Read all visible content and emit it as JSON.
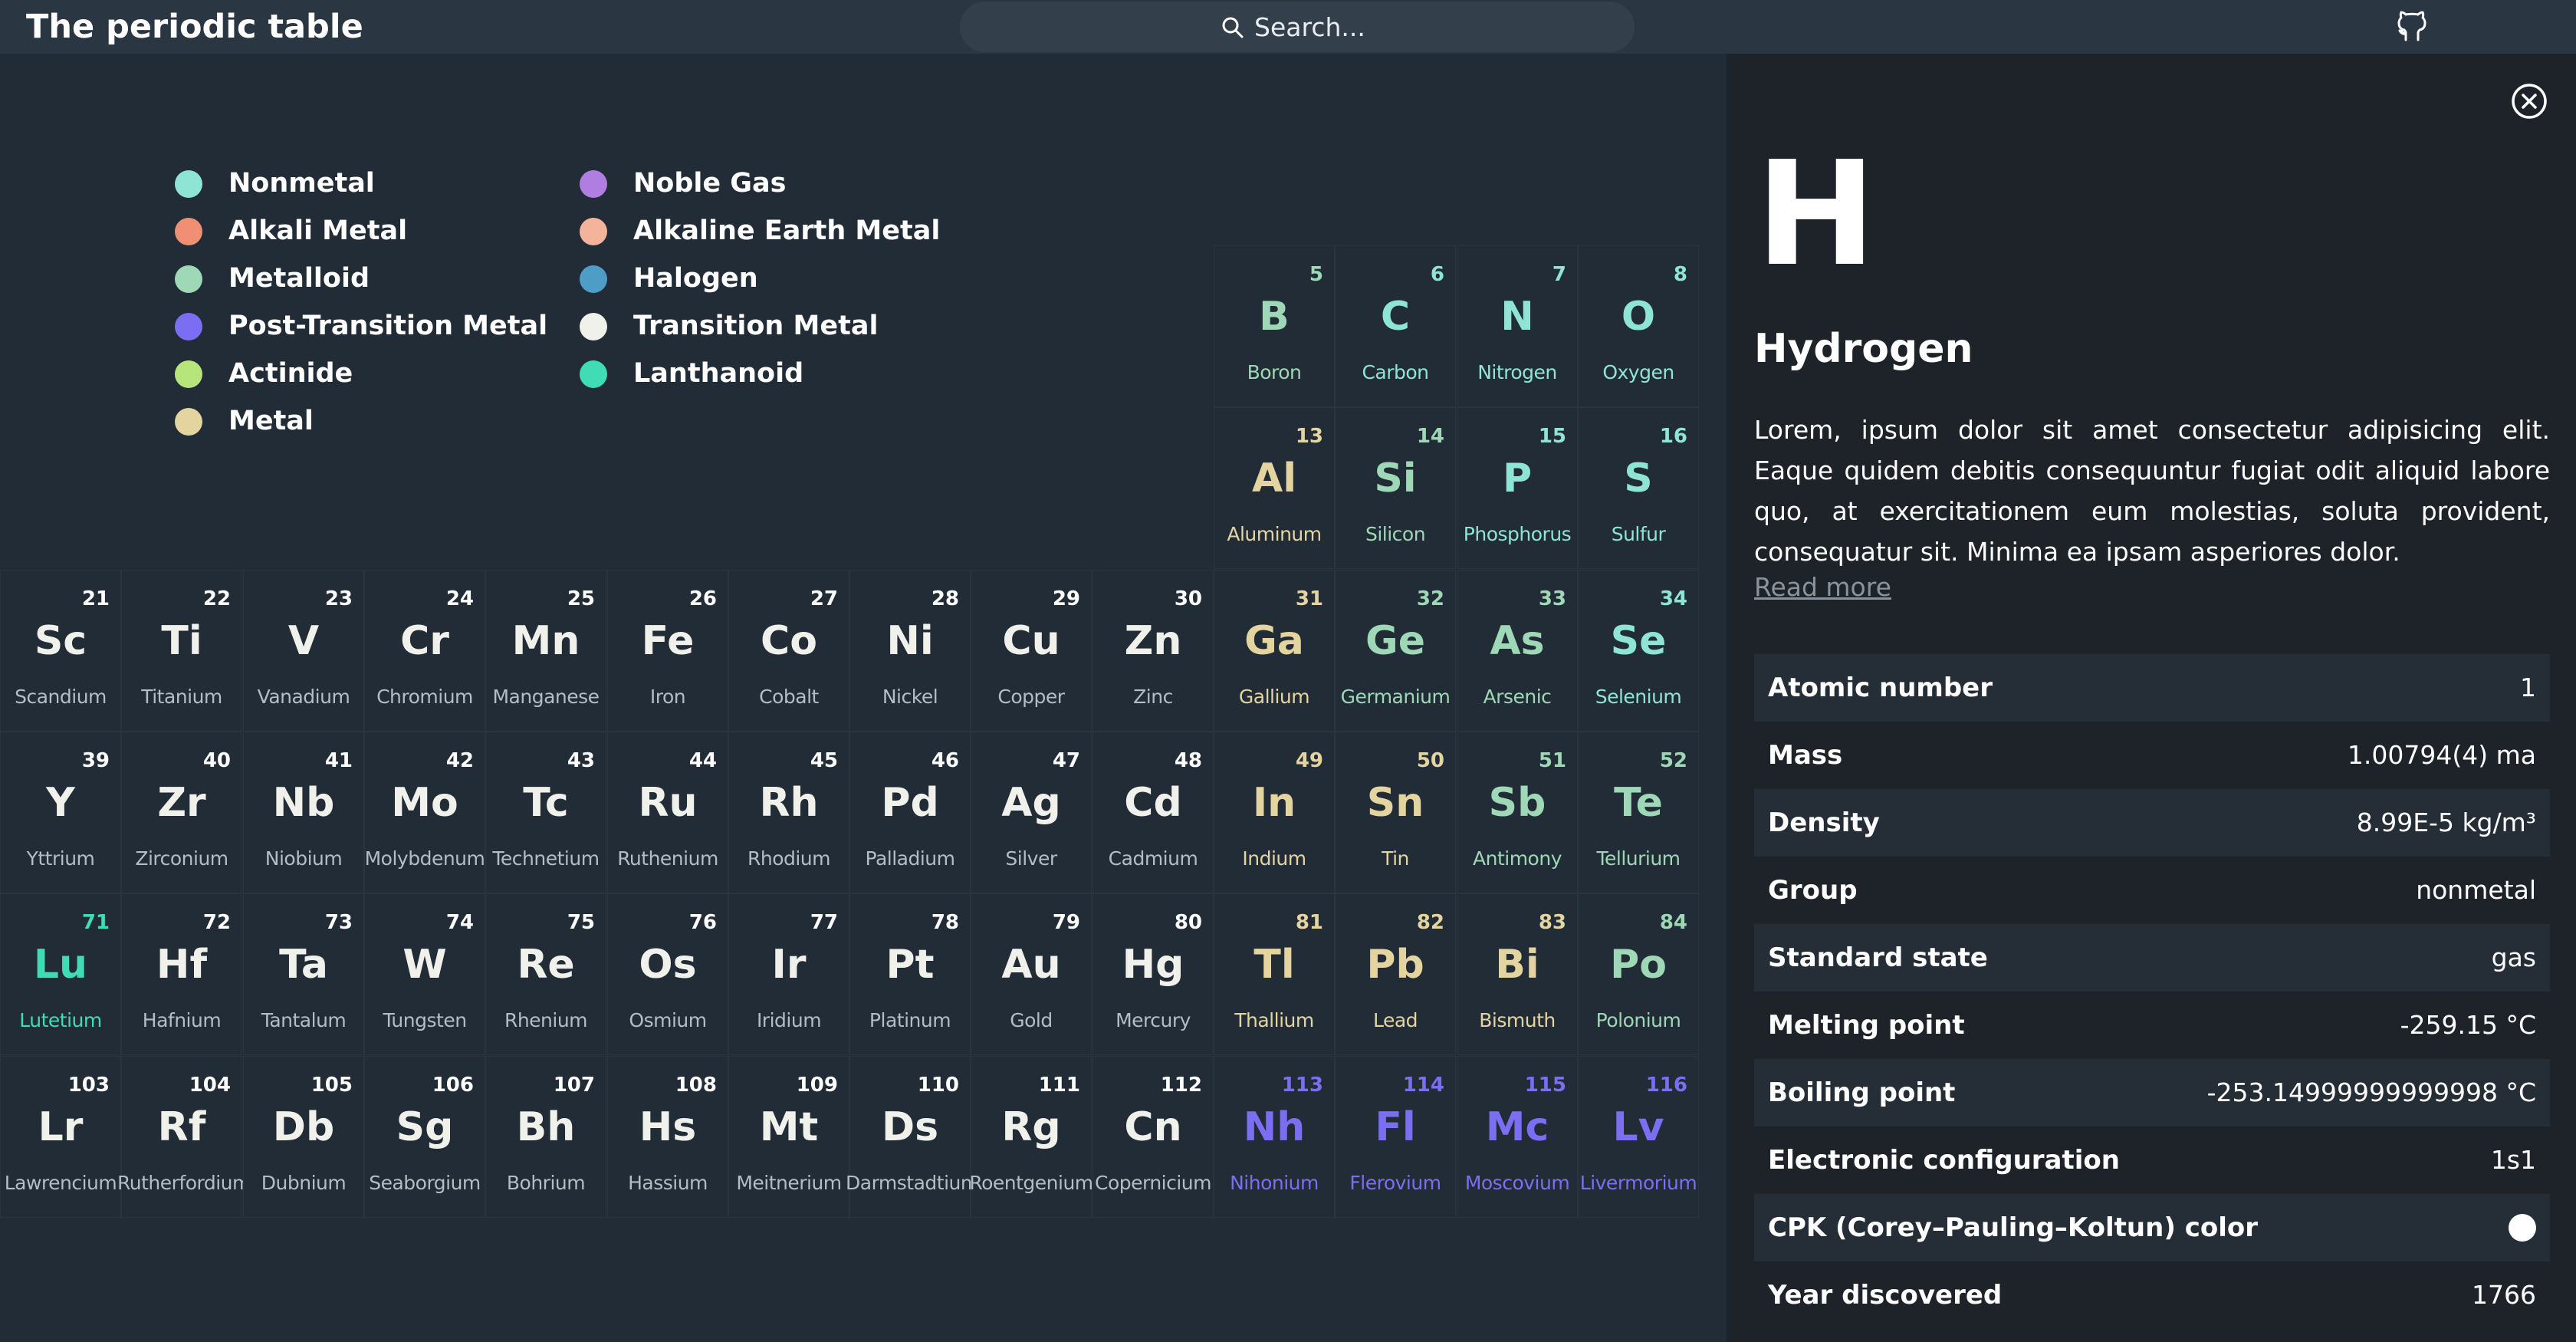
{
  "header": {
    "title": "The periodic table",
    "search_placeholder": "Search..."
  },
  "legend": [
    {
      "label": "Nonmetal",
      "color": "#8fe5d4"
    },
    {
      "label": "Alkali Metal",
      "color": "#f08f74"
    },
    {
      "label": "Metalloid",
      "color": "#9fd8b6"
    },
    {
      "label": "Post-Transition Metal",
      "color": "#7b6ef2"
    },
    {
      "label": "Actinide",
      "color": "#b6e57b"
    },
    {
      "label": "Metal",
      "color": "#e4d4a0"
    },
    {
      "label": "Noble Gas",
      "color": "#b07ee0"
    },
    {
      "label": "Alkaline Earth Metal",
      "color": "#f4b49c"
    },
    {
      "label": "Halogen",
      "color": "#4e9dc7"
    },
    {
      "label": "Transition Metal",
      "color": "#f1f1ec"
    },
    {
      "label": "Lanthanoid",
      "color": "#3fdcb6"
    }
  ],
  "elements": [
    {
      "num": "5",
      "sym": "B",
      "name": "Boron",
      "color": "#9fd8b6",
      "row": 0,
      "col": 10
    },
    {
      "num": "6",
      "sym": "C",
      "name": "Carbon",
      "color": "#8fe5d4",
      "row": 0,
      "col": 11
    },
    {
      "num": "7",
      "sym": "N",
      "name": "Nitrogen",
      "color": "#8fe5d4",
      "row": 0,
      "col": 12
    },
    {
      "num": "8",
      "sym": "O",
      "name": "Oxygen",
      "color": "#8fe5d4",
      "row": 0,
      "col": 13
    },
    {
      "num": "13",
      "sym": "Al",
      "name": "Aluminum",
      "color": "#e4d4a0",
      "row": 1,
      "col": 10
    },
    {
      "num": "14",
      "sym": "Si",
      "name": "Silicon",
      "color": "#9fd8b6",
      "row": 1,
      "col": 11
    },
    {
      "num": "15",
      "sym": "P",
      "name": "Phosphorus",
      "color": "#8fe5d4",
      "row": 1,
      "col": 12
    },
    {
      "num": "16",
      "sym": "S",
      "name": "Sulfur",
      "color": "#8fe5d4",
      "row": 1,
      "col": 13
    },
    {
      "num": "21",
      "sym": "Sc",
      "name": "Scandium",
      "color": "#f1f1ec",
      "row": 2,
      "col": 0
    },
    {
      "num": "22",
      "sym": "Ti",
      "name": "Titanium",
      "color": "#f1f1ec",
      "row": 2,
      "col": 1
    },
    {
      "num": "23",
      "sym": "V",
      "name": "Vanadium",
      "color": "#f1f1ec",
      "row": 2,
      "col": 2
    },
    {
      "num": "24",
      "sym": "Cr",
      "name": "Chromium",
      "color": "#f1f1ec",
      "row": 2,
      "col": 3
    },
    {
      "num": "25",
      "sym": "Mn",
      "name": "Manganese",
      "color": "#f1f1ec",
      "row": 2,
      "col": 4
    },
    {
      "num": "26",
      "sym": "Fe",
      "name": "Iron",
      "color": "#f1f1ec",
      "row": 2,
      "col": 5
    },
    {
      "num": "27",
      "sym": "Co",
      "name": "Cobalt",
      "color": "#f1f1ec",
      "row": 2,
      "col": 6
    },
    {
      "num": "28",
      "sym": "Ni",
      "name": "Nickel",
      "color": "#f1f1ec",
      "row": 2,
      "col": 7
    },
    {
      "num": "29",
      "sym": "Cu",
      "name": "Copper",
      "color": "#f1f1ec",
      "row": 2,
      "col": 8
    },
    {
      "num": "30",
      "sym": "Zn",
      "name": "Zinc",
      "color": "#f1f1ec",
      "row": 2,
      "col": 9
    },
    {
      "num": "31",
      "sym": "Ga",
      "name": "Gallium",
      "color": "#e4d4a0",
      "row": 2,
      "col": 10
    },
    {
      "num": "32",
      "sym": "Ge",
      "name": "Germanium",
      "color": "#9fd8b6",
      "row": 2,
      "col": 11
    },
    {
      "num": "33",
      "sym": "As",
      "name": "Arsenic",
      "color": "#9fd8b6",
      "row": 2,
      "col": 12
    },
    {
      "num": "34",
      "sym": "Se",
      "name": "Selenium",
      "color": "#8fe5d4",
      "row": 2,
      "col": 13
    },
    {
      "num": "39",
      "sym": "Y",
      "name": "Yttrium",
      "color": "#f1f1ec",
      "row": 3,
      "col": 0
    },
    {
      "num": "40",
      "sym": "Zr",
      "name": "Zirconium",
      "color": "#f1f1ec",
      "row": 3,
      "col": 1
    },
    {
      "num": "41",
      "sym": "Nb",
      "name": "Niobium",
      "color": "#f1f1ec",
      "row": 3,
      "col": 2
    },
    {
      "num": "42",
      "sym": "Mo",
      "name": "Molybdenum",
      "color": "#f1f1ec",
      "row": 3,
      "col": 3
    },
    {
      "num": "43",
      "sym": "Tc",
      "name": "Technetium",
      "color": "#f1f1ec",
      "row": 3,
      "col": 4
    },
    {
      "num": "44",
      "sym": "Ru",
      "name": "Ruthenium",
      "color": "#f1f1ec",
      "row": 3,
      "col": 5
    },
    {
      "num": "45",
      "sym": "Rh",
      "name": "Rhodium",
      "color": "#f1f1ec",
      "row": 3,
      "col": 6
    },
    {
      "num": "46",
      "sym": "Pd",
      "name": "Palladium",
      "color": "#f1f1ec",
      "row": 3,
      "col": 7
    },
    {
      "num": "47",
      "sym": "Ag",
      "name": "Silver",
      "color": "#f1f1ec",
      "row": 3,
      "col": 8
    },
    {
      "num": "48",
      "sym": "Cd",
      "name": "Cadmium",
      "color": "#f1f1ec",
      "row": 3,
      "col": 9
    },
    {
      "num": "49",
      "sym": "In",
      "name": "Indium",
      "color": "#e4d4a0",
      "row": 3,
      "col": 10
    },
    {
      "num": "50",
      "sym": "Sn",
      "name": "Tin",
      "color": "#e4d4a0",
      "row": 3,
      "col": 11
    },
    {
      "num": "51",
      "sym": "Sb",
      "name": "Antimony",
      "color": "#9fd8b6",
      "row": 3,
      "col": 12
    },
    {
      "num": "52",
      "sym": "Te",
      "name": "Tellurium",
      "color": "#9fd8b6",
      "row": 3,
      "col": 13
    },
    {
      "num": "71",
      "sym": "Lu",
      "name": "Lutetium",
      "color": "#3fdcb6",
      "row": 4,
      "col": 0
    },
    {
      "num": "72",
      "sym": "Hf",
      "name": "Hafnium",
      "color": "#f1f1ec",
      "row": 4,
      "col": 1
    },
    {
      "num": "73",
      "sym": "Ta",
      "name": "Tantalum",
      "color": "#f1f1ec",
      "row": 4,
      "col": 2
    },
    {
      "num": "74",
      "sym": "W",
      "name": "Tungsten",
      "color": "#f1f1ec",
      "row": 4,
      "col": 3
    },
    {
      "num": "75",
      "sym": "Re",
      "name": "Rhenium",
      "color": "#f1f1ec",
      "row": 4,
      "col": 4
    },
    {
      "num": "76",
      "sym": "Os",
      "name": "Osmium",
      "color": "#f1f1ec",
      "row": 4,
      "col": 5
    },
    {
      "num": "77",
      "sym": "Ir",
      "name": "Iridium",
      "color": "#f1f1ec",
      "row": 4,
      "col": 6
    },
    {
      "num": "78",
      "sym": "Pt",
      "name": "Platinum",
      "color": "#f1f1ec",
      "row": 4,
      "col": 7
    },
    {
      "num": "79",
      "sym": "Au",
      "name": "Gold",
      "color": "#f1f1ec",
      "row": 4,
      "col": 8
    },
    {
      "num": "80",
      "sym": "Hg",
      "name": "Mercury",
      "color": "#f1f1ec",
      "row": 4,
      "col": 9
    },
    {
      "num": "81",
      "sym": "Tl",
      "name": "Thallium",
      "color": "#e4d4a0",
      "row": 4,
      "col": 10
    },
    {
      "num": "82",
      "sym": "Pb",
      "name": "Lead",
      "color": "#e4d4a0",
      "row": 4,
      "col": 11
    },
    {
      "num": "83",
      "sym": "Bi",
      "name": "Bismuth",
      "color": "#e4d4a0",
      "row": 4,
      "col": 12
    },
    {
      "num": "84",
      "sym": "Po",
      "name": "Polonium",
      "color": "#9fd8b6",
      "row": 4,
      "col": 13
    },
    {
      "num": "103",
      "sym": "Lr",
      "name": "Lawrencium",
      "color": "#f1f1ec",
      "row": 5,
      "col": 0
    },
    {
      "num": "104",
      "sym": "Rf",
      "name": "Rutherfordium",
      "color": "#f1f1ec",
      "row": 5,
      "col": 1
    },
    {
      "num": "105",
      "sym": "Db",
      "name": "Dubnium",
      "color": "#f1f1ec",
      "row": 5,
      "col": 2
    },
    {
      "num": "106",
      "sym": "Sg",
      "name": "Seaborgium",
      "color": "#f1f1ec",
      "row": 5,
      "col": 3
    },
    {
      "num": "107",
      "sym": "Bh",
      "name": "Bohrium",
      "color": "#f1f1ec",
      "row": 5,
      "col": 4
    },
    {
      "num": "108",
      "sym": "Hs",
      "name": "Hassium",
      "color": "#f1f1ec",
      "row": 5,
      "col": 5
    },
    {
      "num": "109",
      "sym": "Mt",
      "name": "Meitnerium",
      "color": "#f1f1ec",
      "row": 5,
      "col": 6
    },
    {
      "num": "110",
      "sym": "Ds",
      "name": "Darmstadtium",
      "color": "#f1f1ec",
      "row": 5,
      "col": 7
    },
    {
      "num": "111",
      "sym": "Rg",
      "name": "Roentgenium",
      "color": "#f1f1ec",
      "row": 5,
      "col": 8
    },
    {
      "num": "112",
      "sym": "Cn",
      "name": "Copernicium",
      "color": "#f1f1ec",
      "row": 5,
      "col": 9
    },
    {
      "num": "113",
      "sym": "Nh",
      "name": "Nihonium",
      "color": "#7b6ef2",
      "row": 5,
      "col": 10
    },
    {
      "num": "114",
      "sym": "Fl",
      "name": "Flerovium",
      "color": "#7b6ef2",
      "row": 5,
      "col": 11
    },
    {
      "num": "115",
      "sym": "Mc",
      "name": "Moscovium",
      "color": "#7b6ef2",
      "row": 5,
      "col": 12
    },
    {
      "num": "116",
      "sym": "Lv",
      "name": "Livermorium",
      "color": "#7b6ef2",
      "row": 5,
      "col": 13
    }
  ],
  "detail": {
    "symbol": "H",
    "name": "Hydrogen",
    "description": "Lorem, ipsum dolor sit amet consectetur adipisicing elit. Eaque quidem debitis consequuntur fugiat odit aliquid labore quo, at exercitationem eum molestias, soluta provident, consequatur sit. Minima ea ipsam asperiores dolor.",
    "read_more": "Read more",
    "properties": [
      {
        "label": "Atomic number",
        "value": "1"
      },
      {
        "label": "Mass",
        "value": "1.00794(4) ma"
      },
      {
        "label": "Density",
        "value": "8.99E-5 kg/m³"
      },
      {
        "label": "Group",
        "value": "nonmetal"
      },
      {
        "label": "Standard state",
        "value": "gas"
      },
      {
        "label": "Melting point",
        "value": "-259.15 °C"
      },
      {
        "label": "Boiling point",
        "value": "-253.14999999999998 °C"
      },
      {
        "label": "Electronic configuration",
        "value": "1s1"
      },
      {
        "label": "CPK (Corey–Pauling–Koltun) color",
        "value": "",
        "swatch": "#ffffff"
      },
      {
        "label": "Year discovered",
        "value": "1766"
      }
    ]
  },
  "icons": {
    "search": "search-icon",
    "github": "github-icon",
    "close": "close-circle-icon"
  }
}
